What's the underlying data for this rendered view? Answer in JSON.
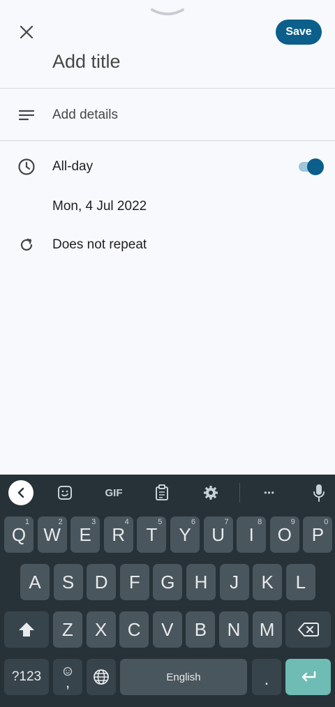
{
  "header": {
    "save_label": "Save",
    "title_placeholder": "Add title"
  },
  "details": {
    "placeholder": "Add details"
  },
  "all_day": {
    "label": "All-day",
    "enabled": true
  },
  "date": {
    "label": "Mon, 4 Jul 2022"
  },
  "repeat": {
    "label": "Does not repeat"
  },
  "keyboard": {
    "toolbar": {
      "back": "back",
      "sticker": "sticker",
      "gif": "GIF",
      "clipboard": "clipboard",
      "settings": "settings",
      "more": "•••",
      "mic": "mic"
    },
    "row1": [
      {
        "key": "Q",
        "hint": "1"
      },
      {
        "key": "W",
        "hint": "2"
      },
      {
        "key": "E",
        "hint": "3"
      },
      {
        "key": "R",
        "hint": "4"
      },
      {
        "key": "T",
        "hint": "5"
      },
      {
        "key": "Y",
        "hint": "6"
      },
      {
        "key": "U",
        "hint": "7"
      },
      {
        "key": "I",
        "hint": "8"
      },
      {
        "key": "O",
        "hint": "9"
      },
      {
        "key": "P",
        "hint": "0"
      }
    ],
    "row2": [
      "A",
      "S",
      "D",
      "F",
      "G",
      "H",
      "J",
      "K",
      "L"
    ],
    "row3": [
      "Z",
      "X",
      "C",
      "V",
      "B",
      "N",
      "M"
    ],
    "symbols_label": "?123",
    "emoji_comma": ",",
    "space_label": "English",
    "period_label": "."
  }
}
